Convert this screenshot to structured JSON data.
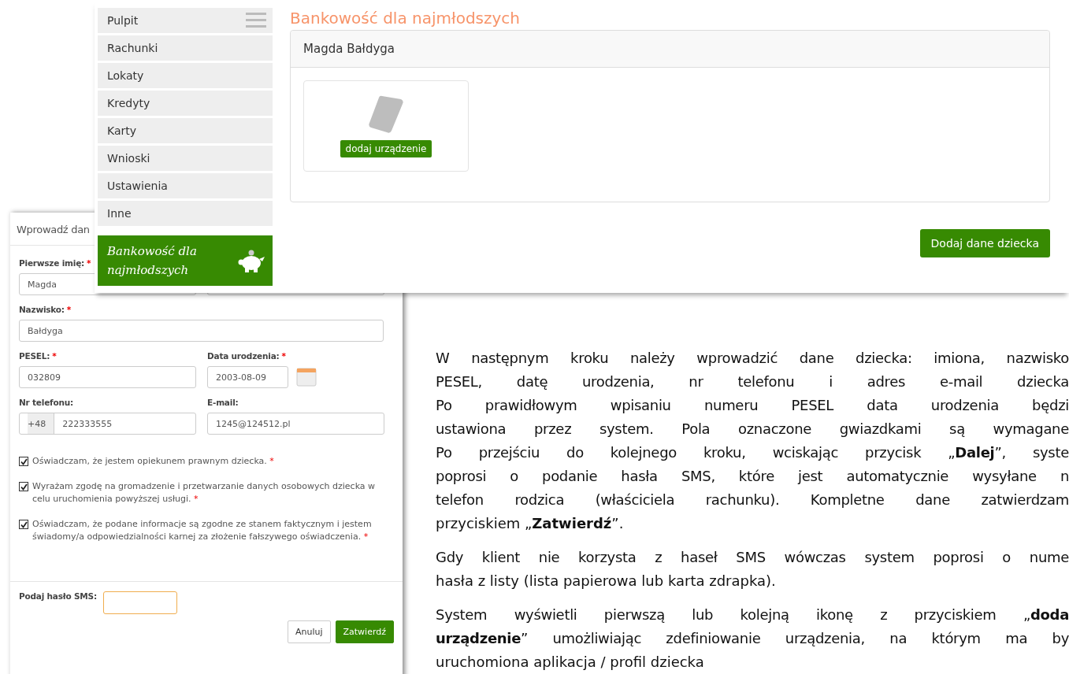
{
  "app_window": {
    "sidebar": {
      "menu_items": [
        {
          "label": "Pulpit",
          "selected": false,
          "kind": "menu"
        },
        {
          "label": "Rachunki",
          "selected": false,
          "kind": "plain"
        },
        {
          "label": "Lokaty",
          "selected": false,
          "kind": "plain"
        },
        {
          "label": "Kredyty",
          "selected": false,
          "kind": "plain"
        },
        {
          "label": "Karty",
          "selected": false,
          "kind": "plain"
        },
        {
          "label": "Wnioski",
          "selected": false,
          "kind": "plain"
        },
        {
          "label": "Ustawienia",
          "selected": false,
          "kind": "plain"
        },
        {
          "label": "Inne",
          "selected": false,
          "kind": "plain"
        },
        {
          "label": "Bankowość dla najmłodszych",
          "selected": true,
          "kind": "feature"
        }
      ]
    },
    "page_title": "Bankowość dla najmłodszych",
    "child_card": {
      "name": "Magda Bałdyga",
      "add_device_button": "dodaj urządzenie"
    },
    "add_child_button": "Dodaj dane dziecka"
  },
  "form_window": {
    "title": "Wprowadź dan",
    "rows": [
      [
        {
          "label": "Pierwsze imię:",
          "required": "*",
          "value": "Magda"
        },
        {}
      ],
      [
        {
          "label": "Nazwisko:",
          "required": "*",
          "value": "Bałdyga"
        }
      ],
      [
        {
          "label": "PESEL:",
          "required": "*",
          "value": "032809"
        },
        {
          "label": "Data urodzenia:",
          "required": "*",
          "value": "2003-08-09",
          "kind": "date"
        }
      ],
      [
        {
          "label": "Nr telefonu:",
          "prefix": "+48",
          "value": "222333555"
        },
        {
          "label": "E-mail:",
          "value": "1245@124512.pl"
        }
      ]
    ],
    "consents": [
      {
        "text": "Oświadczam, że jestem opiekunem prawnym dziecka.",
        "required": "*",
        "checked": true
      },
      {
        "text": "Wyrażam zgodę na gromadzenie i przetwarzanie danych osobowych dziecka w celu uruchomienia powyższej usługi.",
        "required": "*",
        "checked": true
      },
      {
        "text": "Oświadczam, że podane informacje są zgodne ze stanem faktycznym i jestem świadomy/a odpowiedzialności karnej za złożenie fałszywego oświadczenia.",
        "required": "*",
        "checked": true
      }
    ],
    "sms_field": {
      "label": "Podaj hasło SMS:",
      "focused": true
    },
    "buttons": [
      {
        "label": "Anuluj",
        "kind": "default"
      },
      {
        "label": "Zatwierdź",
        "kind": "primary"
      }
    ]
  },
  "document_text": [
    {
      "lines": [
        "W następnym kroku należy wprowadzić dane dziecka: imiona, nazwisko",
        "PESEL, datę urodzenia, nr telefonu i adres e-mail dziecka",
        "Po prawidłowym wpisaniu numeru PESEL data urodzenia będzi",
        "ustawiona przez system. Pola oznaczone gwiazdkami są wymagane",
        "Po przejściu do kolejnego kroku, wciskając przycisk „**Dalej**”, syste",
        "poprosi o podanie hasła SMS, które jest automatycznie wysyłane n",
        "telefon rodzica (właściciela rachunku). Kompletne dane zatwierdzam",
        "przyciskiem „**Zatwierdź**”."
      ]
    },
    {
      "lines": [
        "Gdy klient nie korzysta z haseł SMS wówczas system poprosi o nume",
        "hasła z listy (lista papierowa lub karta zdrapka)."
      ]
    },
    {
      "lines": [
        "System wyświetli pierwszą lub kolejną ikonę z przyciskiem „**doda**",
        "**urządzenie**” umożliwiając zdefiniowanie urządzenia, na którym ma by",
        "uruchomiona aplikacja / profil dziecka"
      ]
    }
  ]
}
